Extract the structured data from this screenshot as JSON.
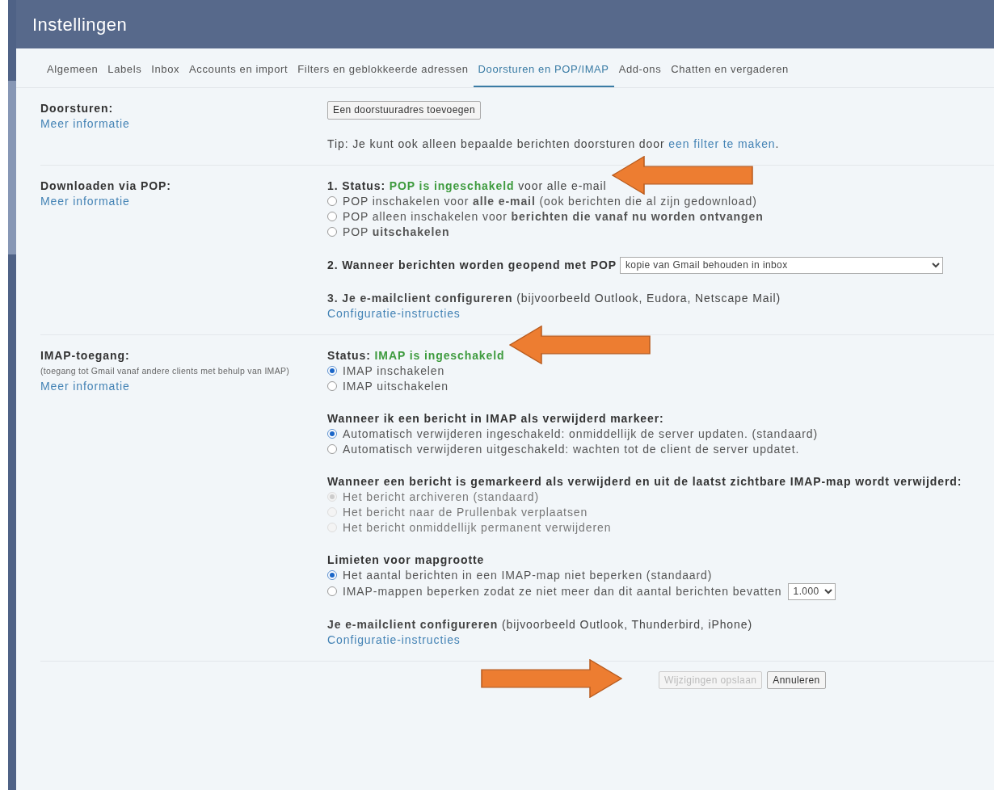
{
  "window": {
    "title": "Instellingen"
  },
  "tabs": [
    {
      "label": "Algemeen",
      "selected": false
    },
    {
      "label": "Labels",
      "selected": false
    },
    {
      "label": "Inbox",
      "selected": false
    },
    {
      "label": "Accounts en import",
      "selected": false
    },
    {
      "label": "Filters en geblokkeerde adressen",
      "selected": false
    },
    {
      "label": "Doorsturen en POP/IMAP",
      "selected": true
    },
    {
      "label": "Add-ons",
      "selected": false
    },
    {
      "label": "Chatten en vergaderen",
      "selected": false
    }
  ],
  "sections": [
    {
      "label": "Doorsturen:",
      "link": "Meer informatie",
      "groups": [
        [
          {
            "kind": "button",
            "text": "Een doorstuuradres toevoegen"
          }
        ],
        [
          {
            "kind": "tip",
            "text": "Tip: Je kunt ook alleen bepaalde berichten doorsturen door ",
            "link": "een filter te maken",
            "end": "."
          }
        ]
      ]
    },
    {
      "label": "Downloaden via POP:",
      "link": "Meer informatie",
      "groups": [
        [
          {
            "kind": "status",
            "label": "1. Status:",
            "value": "POP is ingeschakeld",
            "suffix": "voor alle e-mail",
            "annotation": {
              "kind": "left-arrow"
            }
          },
          {
            "kind": "radio",
            "text": "POP inschakelen voor **alle e-mail** (ook berichten die al zijn gedownload)",
            "checked": false,
            "disabled": false
          },
          {
            "kind": "radio",
            "text": "POP alleen inschakelen voor **berichten die vanaf nu worden ontvangen**",
            "checked": false,
            "disabled": false
          },
          {
            "kind": "radio",
            "text": "POP **uitschakelen**",
            "checked": false,
            "disabled": false
          }
        ],
        [
          {
            "kind": "select",
            "label": "2. Wanneer berichten worden geopend met POP",
            "value": "kopie van Gmail behouden in inbox"
          }
        ],
        [
          {
            "kind": "text",
            "text": "**3. Je e-mailclient configureren** (bijvoorbeeld Outlook, Eudora, Netscape Mail)"
          },
          {
            "kind": "link",
            "text": "Configuratie-instructies"
          }
        ]
      ]
    },
    {
      "label": "IMAP-toegang:",
      "description": "(toegang tot Gmail vanaf andere clients met behulp van IMAP)",
      "link": "Meer informatie",
      "groups": [
        [
          {
            "kind": "status",
            "label": "Status:",
            "value": "IMAP is ingeschakeld",
            "annotation": {
              "kind": "left-arrow"
            }
          },
          {
            "kind": "radio",
            "text": "IMAP inschakelen",
            "checked": true,
            "disabled": false
          },
          {
            "kind": "radio",
            "text": "IMAP uitschakelen",
            "checked": false,
            "disabled": false
          }
        ],
        [
          {
            "kind": "heading",
            "text": "Wanneer ik een bericht in IMAP als verwijderd markeer:"
          },
          {
            "kind": "radio",
            "text": "Automatisch verwijderen ingeschakeld: onmiddellijk de server updaten. (standaard)",
            "checked": true,
            "disabled": false
          },
          {
            "kind": "radio",
            "text": "Automatisch verwijderen uitgeschakeld: wachten tot de client de server updatet.",
            "checked": false,
            "disabled": false
          }
        ],
        [
          {
            "kind": "heading",
            "text": "Wanneer een bericht is gemarkeerd als verwijderd en uit de laatst zichtbare IMAP-map wordt verwijderd:"
          },
          {
            "kind": "radio",
            "text": "Het bericht archiveren (standaard)",
            "checked": true,
            "disabled": true
          },
          {
            "kind": "radio",
            "text": "Het bericht naar de Prullenbak verplaatsen",
            "checked": false,
            "disabled": true
          },
          {
            "kind": "radio",
            "text": "Het bericht onmiddellijk permanent verwijderen",
            "checked": false,
            "disabled": true
          }
        ],
        [
          {
            "kind": "heading",
            "text": "Limieten voor mapgrootte"
          },
          {
            "kind": "radio",
            "text": "Het aantal berichten in een IMAP-map niet beperken (standaard)",
            "checked": true,
            "disabled": false
          },
          {
            "kind": "radio",
            "text": "IMAP-mappen beperken zodat ze niet meer dan dit aantal berichten bevatten",
            "checked": false,
            "disabled": false,
            "select": "1.000"
          }
        ],
        [
          {
            "kind": "text",
            "text": "**Je e-mailclient configureren** (bijvoorbeeld Outlook, Thunderbird, iPhone)"
          },
          {
            "kind": "link",
            "text": "Configuratie-instructies"
          }
        ]
      ]
    }
  ],
  "footer": {
    "annotation": {
      "kind": "right-arrow"
    },
    "buttons": [
      {
        "text": "Wijzigingen opslaan",
        "disabled": true
      },
      {
        "text": "Annuleren",
        "disabled": false
      }
    ]
  }
}
